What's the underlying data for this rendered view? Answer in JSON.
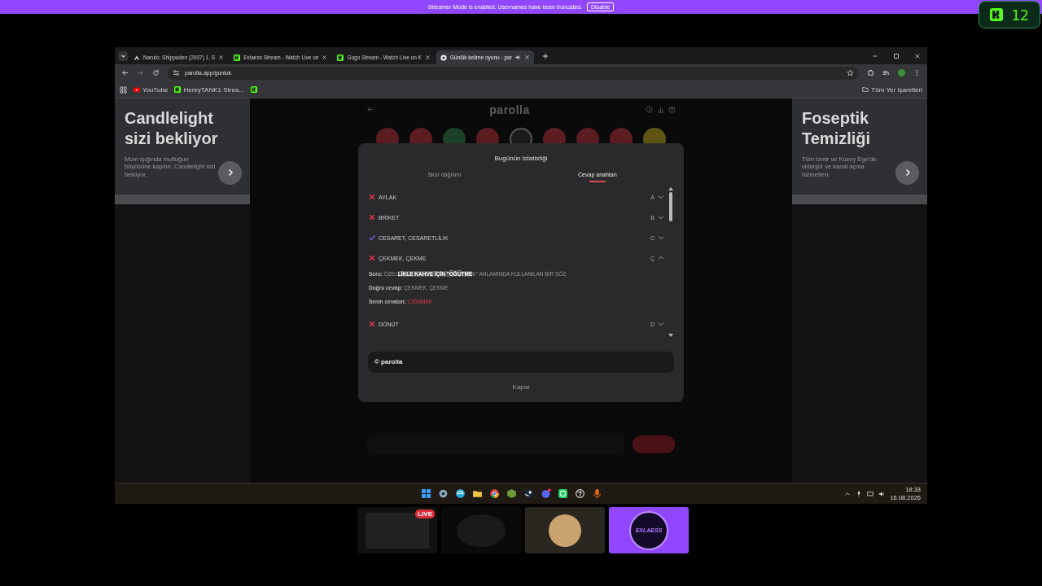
{
  "banner": {
    "message": "Streamer Mode is enabled. Usernames have been truncated.",
    "button": "Disable"
  },
  "badge": {
    "count": "12"
  },
  "browser": {
    "tabs": [
      {
        "title": "Naruto: Shippuden (2007) 1. S",
        "kind": "peak",
        "selected": false,
        "audio": false
      },
      {
        "title": "Exlaess Stream - Watch Live on",
        "kind": "green",
        "selected": false,
        "audio": false
      },
      {
        "title": "Gogo Stream - Watch Live on K",
        "kind": "green",
        "selected": false,
        "audio": false
      },
      {
        "title": "Günlük kelime oyunu - par",
        "kind": "circle",
        "selected": true,
        "audio": true
      }
    ],
    "address": "parolla.app/gunluk",
    "bookmarks": [
      {
        "label": "YouTube",
        "kind": "play"
      },
      {
        "label": "HenryTANK1 Strea...",
        "kind": "green"
      },
      {
        "kind": "green"
      }
    ],
    "all_bookmarks": "Tüm Yer İşaretleri"
  },
  "ads": [
    {
      "headline": "Candlelight sizi bekliyor",
      "body": "Mum ışığında mutluğun büyüsüne kapılın. Candlelight sizi bekliyor."
    },
    {
      "headline": "Foseptik Temizliği",
      "body": "Tüm İzmir ve Kuzey Ege'de vidanjör ve kanal açma hizmetleri."
    }
  ],
  "page": {
    "logo": "parolla",
    "board": [
      {
        "color": "#5b1c22",
        "selected": false
      },
      {
        "color": "#5b1c22",
        "selected": false
      },
      {
        "color": "#1d4028",
        "selected": false
      },
      {
        "color": "#5b1c22",
        "selected": false
      },
      {
        "color": "#1a1a1a",
        "selected": true
      },
      {
        "color": "#5b1c22",
        "selected": false
      },
      {
        "color": "#5b1c22",
        "selected": false
      },
      {
        "color": "#5b1c22",
        "selected": false
      },
      {
        "color": "#5e5514",
        "selected": false
      }
    ]
  },
  "modal": {
    "title": "Bugünün istatistiği",
    "tabs": [
      {
        "label": "Skor dağılımı",
        "selected": false
      },
      {
        "label": "Cevap anahtarı",
        "selected": true
      }
    ],
    "answers": [
      {
        "word": "AYLAK",
        "letter": "A",
        "correct": false,
        "expanded": false
      },
      {
        "word": "BRİKET",
        "letter": "B",
        "correct": false,
        "expanded": false
      },
      {
        "word": "CESARET, CESARETLİLİK",
        "letter": "C",
        "correct": true,
        "expanded": false
      },
      {
        "word": "ÇEKMEK, ÇEKME",
        "letter": "Ç",
        "correct": false,
        "expanded": true,
        "details": [
          {
            "label": "Soru:",
            "value": "ÖZEL**LİKLE KAHVE İÇİN \"ÖĞÜTME**K\" ANLAMINDA KULLANILAN BİR SÖZ",
            "kind": "question"
          },
          {
            "label": "Doğru cevap:",
            "value": "ÇEKMEK, ÇEKME",
            "kind": "correct"
          },
          {
            "label": "Senin cevabın:",
            "value": "ÇİĞNMAK",
            "kind": "wrong"
          }
        ]
      },
      {
        "word": "DÖNÜT",
        "letter": "D",
        "correct": false,
        "expanded": false
      }
    ],
    "footer": "© parolla",
    "close": "Kapat"
  },
  "taskbar": {
    "time": "18:33",
    "date": "16.08.2026"
  },
  "thumbnails": [
    {
      "kind": "screen",
      "badge": "LIVE"
    },
    {
      "kind": "art"
    },
    {
      "kind": "avatar"
    },
    {
      "kind": "logo",
      "text": "EXLAESS"
    }
  ]
}
